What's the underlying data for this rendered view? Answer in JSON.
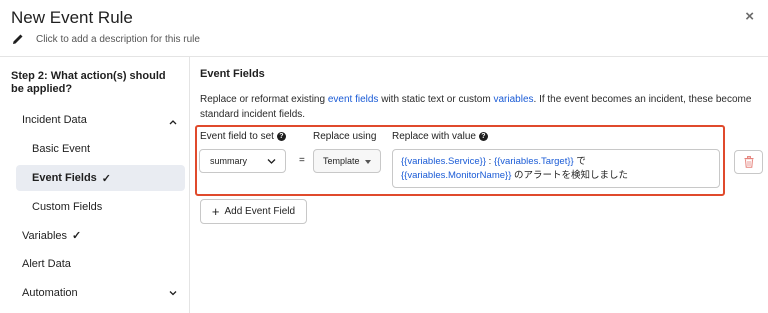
{
  "modal": {
    "title": "New Event Rule",
    "close_label": "×",
    "description_prompt": "Click to add a description for this rule"
  },
  "sidebar": {
    "step_title": "Step 2: What action(s) should be applied?",
    "items": [
      {
        "label": "Incident Data",
        "expanded": true
      },
      {
        "label": "Basic Event"
      },
      {
        "label": "Event Fields",
        "check": "✓",
        "active": true
      },
      {
        "label": "Custom Fields"
      },
      {
        "label": "Variables",
        "check": "✓"
      },
      {
        "label": "Alert Data"
      },
      {
        "label": "Automation",
        "expanded": false
      }
    ]
  },
  "main": {
    "section_title": "Event Fields",
    "description": {
      "part1": "Replace or reformat existing ",
      "link1": "event fields",
      "part2": " with static text or custom ",
      "link2": "variables",
      "part3": ". If the event becomes an incident, these become standard incident fields."
    },
    "rule": {
      "field_label": "Event field to set",
      "mode_label": "Replace using",
      "value_label": "Replace with value",
      "field_value": "summary",
      "equals": "=",
      "mode_value": "Template",
      "value_parts": {
        "var1": "{{variables.Service}}",
        "sep": " : ",
        "var2": "{{variables.Target}}",
        "text1": " で",
        "var3": "{{variables.MonitorName}}",
        "text2": " のアラートを検知しました"
      }
    },
    "add_button_label": "Add Event Field",
    "add_button_icon": "+"
  },
  "colors": {
    "accent_link": "#1a5bd6",
    "highlight_border": "#e04a2c",
    "delete_icon": "#e5817a",
    "active_nav_bg": "#e9ecf2"
  }
}
